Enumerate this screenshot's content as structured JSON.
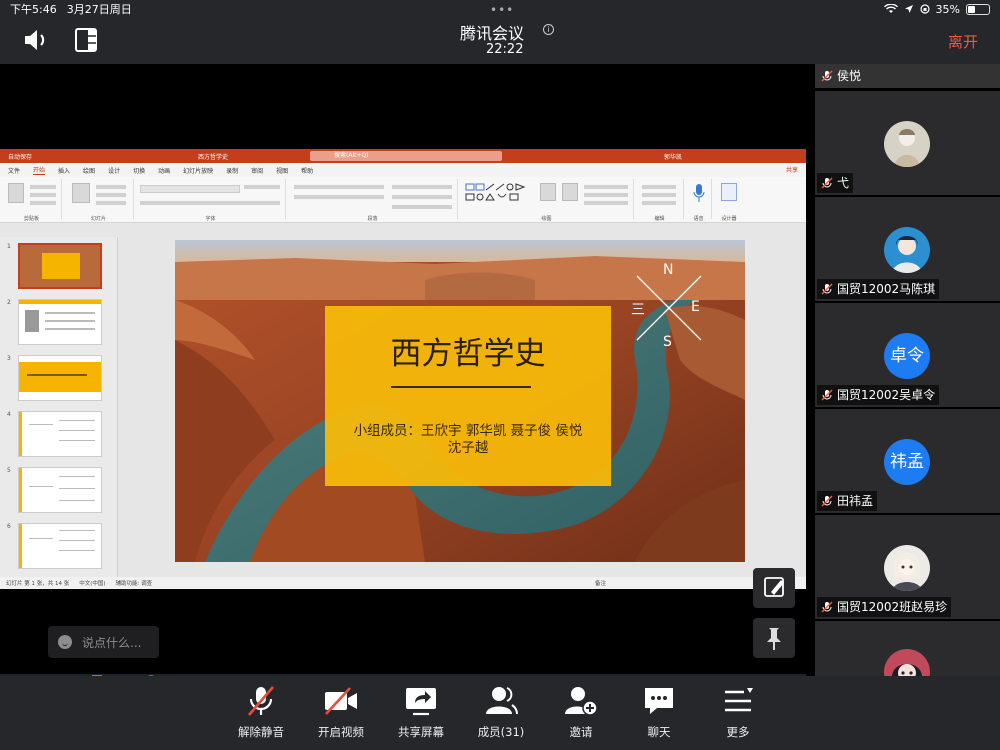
{
  "status_bar": {
    "time": "下午5:46",
    "date": "3月27日周日",
    "dots": "•••",
    "battery_percent": "35%",
    "battery_level": 0.35
  },
  "meeting": {
    "title": "腾讯会议",
    "timer": "22:22",
    "leave_label": "离开"
  },
  "powerpoint": {
    "autosave_label": "自动保存",
    "document_name": "西方哲学史",
    "search_placeholder": "搜索(Alt+Q)",
    "user_name": "郭华凯",
    "tabs": [
      "文件",
      "开始",
      "插入",
      "绘图",
      "设计",
      "切换",
      "动画",
      "幻灯片放映",
      "录制",
      "审阅",
      "视图",
      "帮助"
    ],
    "active_tab": "开始",
    "share_label": "共享",
    "ribbon_groups": [
      "剪贴板",
      "幻灯片",
      "字体",
      "段落",
      "绘图",
      "编辑",
      "语音",
      "设计器"
    ],
    "slide_numbers": [
      "1",
      "2",
      "3",
      "4",
      "5",
      "6"
    ],
    "status_left": "幻灯片 第 1 张，共 14 张",
    "status_lang": "中文(中国)",
    "status_access": "辅助功能: 调查",
    "status_notes": "备注"
  },
  "slide": {
    "title": "西方哲学史",
    "members_line1": "小组成员：王欣宇  郭华凯  聂子俊  侯悦",
    "members_line2": "沈子越",
    "compass": [
      "N",
      "E",
      "S",
      "三"
    ]
  },
  "chat": {
    "placeholder": "说点什么..."
  },
  "participants": [
    {
      "name": "侯悦",
      "avatar": "none"
    },
    {
      "name": "弋",
      "avatar": "photo"
    },
    {
      "name": "国贸12002马陈琪",
      "avatar": "photo"
    },
    {
      "name": "国贸12002吴卓令",
      "avatar": "text",
      "avatar_text": "卓令"
    },
    {
      "name": "田祎孟",
      "avatar": "text",
      "avatar_text": "祎孟"
    },
    {
      "name": "国贸12002班赵易珍",
      "avatar": "photo"
    },
    {
      "name": "",
      "avatar": "photo"
    }
  ],
  "toolbar": {
    "unmute": "解除静音",
    "start_video": "开启视频",
    "share_screen": "共享屏幕",
    "members": "成员(31)",
    "invite": "邀请",
    "chat": "聊天",
    "more": "更多"
  },
  "colors": {
    "accent_leave": "#f05a3c",
    "avatar_blue": "#1e7cf2",
    "ppt_red": "#c43e1c",
    "slide_title_box": "#f5b80a"
  }
}
